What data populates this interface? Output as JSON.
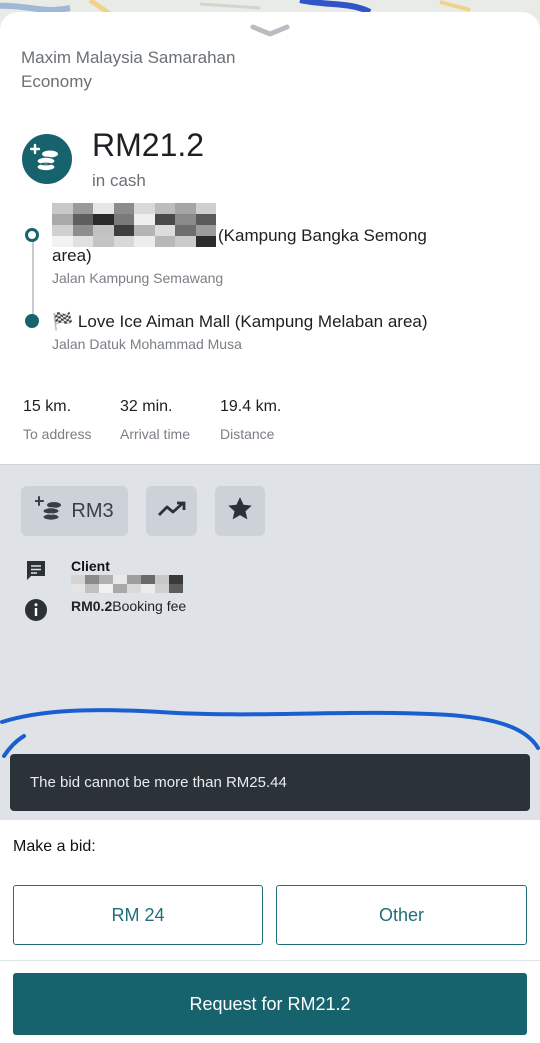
{
  "header": {
    "provider": "Maxim Malaysia Samarahan",
    "tariff": "Economy"
  },
  "price": {
    "amount": "RM21.2",
    "payment": "in cash",
    "icon": "coins-plus-icon"
  },
  "route": {
    "from": {
      "name": "(Kampung Bangka Semong area)",
      "street": "Jalan Kampung Semawang"
    },
    "to": {
      "flag": "🏁",
      "name": "Love Ice Aiman Mall (Kampung Melaban area)",
      "street": "Jalan Datuk Mohammad Musa"
    }
  },
  "stats": [
    {
      "value": "15 km.",
      "label": "To address"
    },
    {
      "value": "32 min.",
      "label": "Arrival time"
    },
    {
      "value": "19.4 km.",
      "label": "Distance"
    }
  ],
  "chips": {
    "tip": "RM3"
  },
  "client": {
    "label": "Client",
    "fee_amount": "RM0.2",
    "fee_label": "Booking fee"
  },
  "toast": {
    "message": "The bid cannot be more than RM25.44"
  },
  "bid": {
    "label": "Make a bid:",
    "option_1": "RM 24",
    "option_2": "Other",
    "request": "Request for RM21.2"
  },
  "colors": {
    "accent": "#17636d",
    "toast_bg": "#2b3238",
    "annotation": "#1a5fd0"
  }
}
